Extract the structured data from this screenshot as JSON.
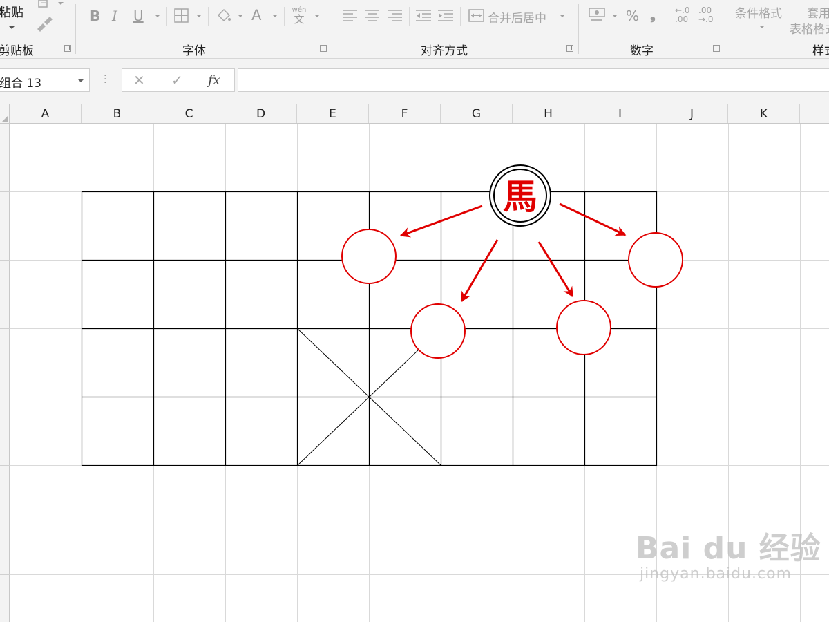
{
  "ribbon": {
    "clipboard": {
      "paste_label": "粘贴",
      "group_label": "剪贴板"
    },
    "font": {
      "bold": "B",
      "italic": "I",
      "underline": "U",
      "font_color_glyph": "A",
      "phonetic_top": "wén",
      "phonetic_bottom": "文",
      "group_label": "字体"
    },
    "alignment": {
      "merge_label": "合并后居中",
      "group_label": "对齐方式"
    },
    "number": {
      "percent": "%",
      "comma": "❟",
      "inc_decimal_top": "←.0",
      "inc_decimal_bottom": ".00",
      "dec_decimal_top": ".00",
      "dec_decimal_bottom": "→.0",
      "group_label": "数字"
    },
    "styles": {
      "conditional_format": "条件格式",
      "table_format_top": "套用",
      "table_format_bottom": "表格格式",
      "group_label": "样式"
    }
  },
  "formula_bar": {
    "name_box": "组合 13",
    "cancel_glyph": "✕",
    "confirm_glyph": "✓",
    "fx_label": "fx",
    "formula_value": ""
  },
  "sheet": {
    "columns": [
      "A",
      "B",
      "C",
      "D",
      "E",
      "F",
      "G",
      "H",
      "I",
      "J",
      "K"
    ]
  },
  "drawing": {
    "piece_char": "馬",
    "piece_color": "#e00000",
    "arrow_color": "#e00000",
    "target_circle_color": "#e00000"
  },
  "watermark": {
    "main": "Bai du 经验",
    "sub": "jingyan.baidu.com"
  }
}
